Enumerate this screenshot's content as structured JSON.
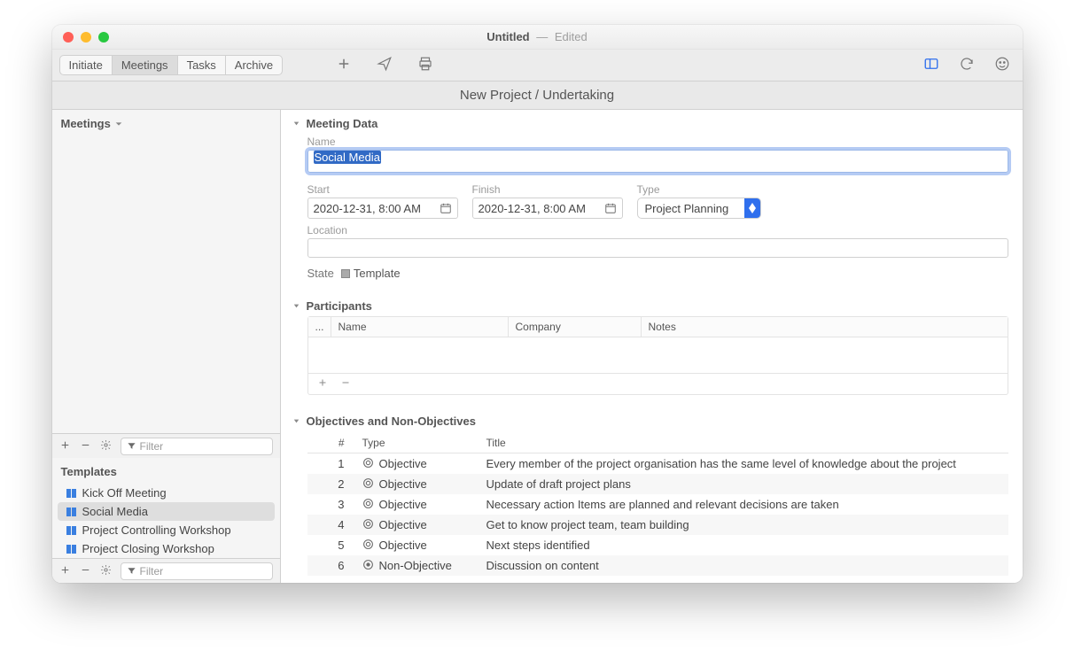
{
  "window": {
    "title": "Untitled",
    "subtitle": "Edited"
  },
  "tabs": [
    "Initiate",
    "Meetings",
    "Tasks",
    "Archive"
  ],
  "tabs_selected_index": 1,
  "header_title": "New Project / Undertaking",
  "sidebar": {
    "meetings_label": "Meetings",
    "templates_label": "Templates",
    "filter_placeholder": "Filter",
    "templates": [
      {
        "label": "Kick Off Meeting",
        "selected": false
      },
      {
        "label": "Social Media",
        "selected": true
      },
      {
        "label": "Project Controlling Workshop",
        "selected": false
      },
      {
        "label": "Project Closing Workshop",
        "selected": false
      }
    ]
  },
  "meeting_data": {
    "section_label": "Meeting Data",
    "name_label": "Name",
    "name_value": "Social Media",
    "start_label": "Start",
    "start_value": "2020-12-31, 8:00 AM",
    "finish_label": "Finish",
    "finish_value": "2020-12-31, 8:00 AM",
    "type_label": "Type",
    "type_value": "Project Planning",
    "location_label": "Location",
    "location_value": "",
    "state_label": "State",
    "state_value": "Template"
  },
  "participants": {
    "section_label": "Participants",
    "columns": [
      "...",
      "Name",
      "Company",
      "Notes"
    ]
  },
  "objectives": {
    "section_label": "Objectives and Non-Objectives",
    "columns": [
      "#",
      "Type",
      "Title"
    ],
    "rows": [
      {
        "num": "1",
        "type": "Objective",
        "title": "Every member of the project organisation has the same level of knowledge about the project"
      },
      {
        "num": "2",
        "type": "Objective",
        "title": "Update of draft project plans"
      },
      {
        "num": "3",
        "type": "Objective",
        "title": "Necessary action Items are planned and relevant decisions are taken"
      },
      {
        "num": "4",
        "type": "Objective",
        "title": "Get to know project team, team building"
      },
      {
        "num": "5",
        "type": "Objective",
        "title": "Next steps identified"
      },
      {
        "num": "6",
        "type": "Non-Objective",
        "title": "Discussion on content"
      }
    ]
  }
}
